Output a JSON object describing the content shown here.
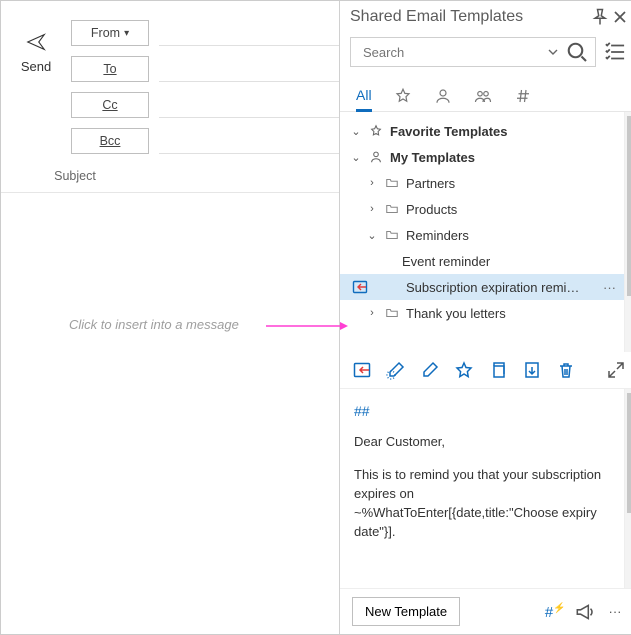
{
  "compose": {
    "send_label": "Send",
    "from_label": "From",
    "to_label": "To",
    "cc_label": "Cc",
    "bcc_label": "Bcc",
    "subject_label": "Subject",
    "callout": "Click to insert into a message"
  },
  "panel": {
    "title": "Shared Email Templates",
    "search_placeholder": "Search",
    "tabs": {
      "all": "All"
    },
    "tree": {
      "favorite": "Favorite Templates",
      "my": "My Templates",
      "partners": "Partners",
      "products": "Products",
      "reminders": "Reminders",
      "event_reminder": "Event reminder",
      "sub_reminder": "Subscription expiration remi…",
      "thankyou": "Thank you letters"
    },
    "preview": {
      "heading": "##",
      "greeting": "Dear Customer,",
      "body": "This is to remind you that your subscription expires on ~%WhatToEnter[{date,title:\"Choose expiry date\"}]."
    },
    "new_template": "New Template"
  }
}
